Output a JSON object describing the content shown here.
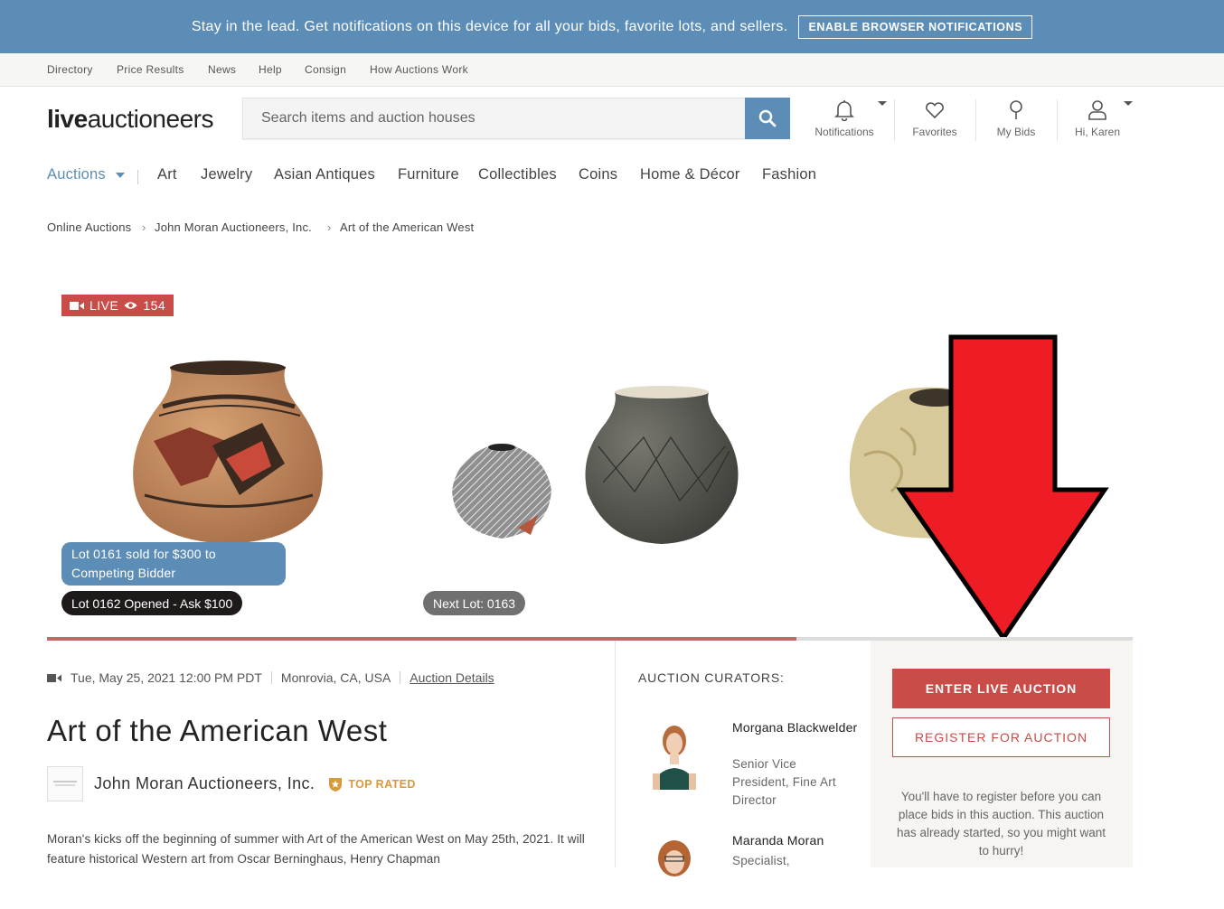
{
  "banner": {
    "text": "Stay in the lead. Get notifications on this device for all your bids, favorite lots, and sellers.",
    "button": "ENABLE BROWSER NOTIFICATIONS"
  },
  "util_nav": [
    "Directory",
    "Price Results",
    "News",
    "Help",
    "Consign",
    "How Auctions Work"
  ],
  "logo": {
    "part1": "live",
    "part2": "auctioneers"
  },
  "search": {
    "placeholder": "Search items and auction houses"
  },
  "header_actions": {
    "notifications": "Notifications",
    "favorites": "Favorites",
    "my_bids": "My Bids",
    "account": "Hi, Karen"
  },
  "categories": [
    "Auctions",
    "Art",
    "Jewelry",
    "Asian Antiques",
    "Furniture",
    "Collectibles",
    "Coins",
    "Home & Décor",
    "Fashion"
  ],
  "breadcrumb": [
    "Online Auctions",
    "John Moran Auctioneers, Inc.",
    "Art of the American West"
  ],
  "live": {
    "label": "LIVE",
    "viewers": "154"
  },
  "lots": {
    "sold": "Lot 0161 sold for  $300  to Competing Bidder",
    "opened": "Lot 0162 Opened - Ask  $100",
    "next": "Next Lot: 0163",
    "progress": 0.69
  },
  "auction": {
    "datetime": "Tue, May 25, 2021 12:00 PM PDT",
    "location": "Monrovia, CA, USA",
    "details_link": "Auction Details",
    "title": "Art of the American West",
    "house": "John Moran Auctioneers, Inc.",
    "badge": "TOP RATED",
    "description": "Moran's kicks off the beginning of summer with Art of the American West on May 25th, 2021. It will feature historical Western art from Oscar Berninghaus, Henry Chapman"
  },
  "curators": {
    "heading": "AUCTION CURATORS:",
    "people": [
      {
        "name": "Morgana Blackwelder",
        "title": "Senior Vice President, Fine Art Director"
      },
      {
        "name": "Maranda Moran",
        "title": "Specialist,"
      }
    ]
  },
  "actions": {
    "enter_live": "ENTER LIVE AUCTION",
    "register": "REGISTER FOR AUCTION",
    "note": "You'll have to register before you can place bids in this auction. This auction has already started, so you might want to hurry!"
  },
  "colors": {
    "brand_blue": "#5b8db7",
    "live_red": "#c94c48",
    "annotation_arrow": "#ee1c24"
  }
}
